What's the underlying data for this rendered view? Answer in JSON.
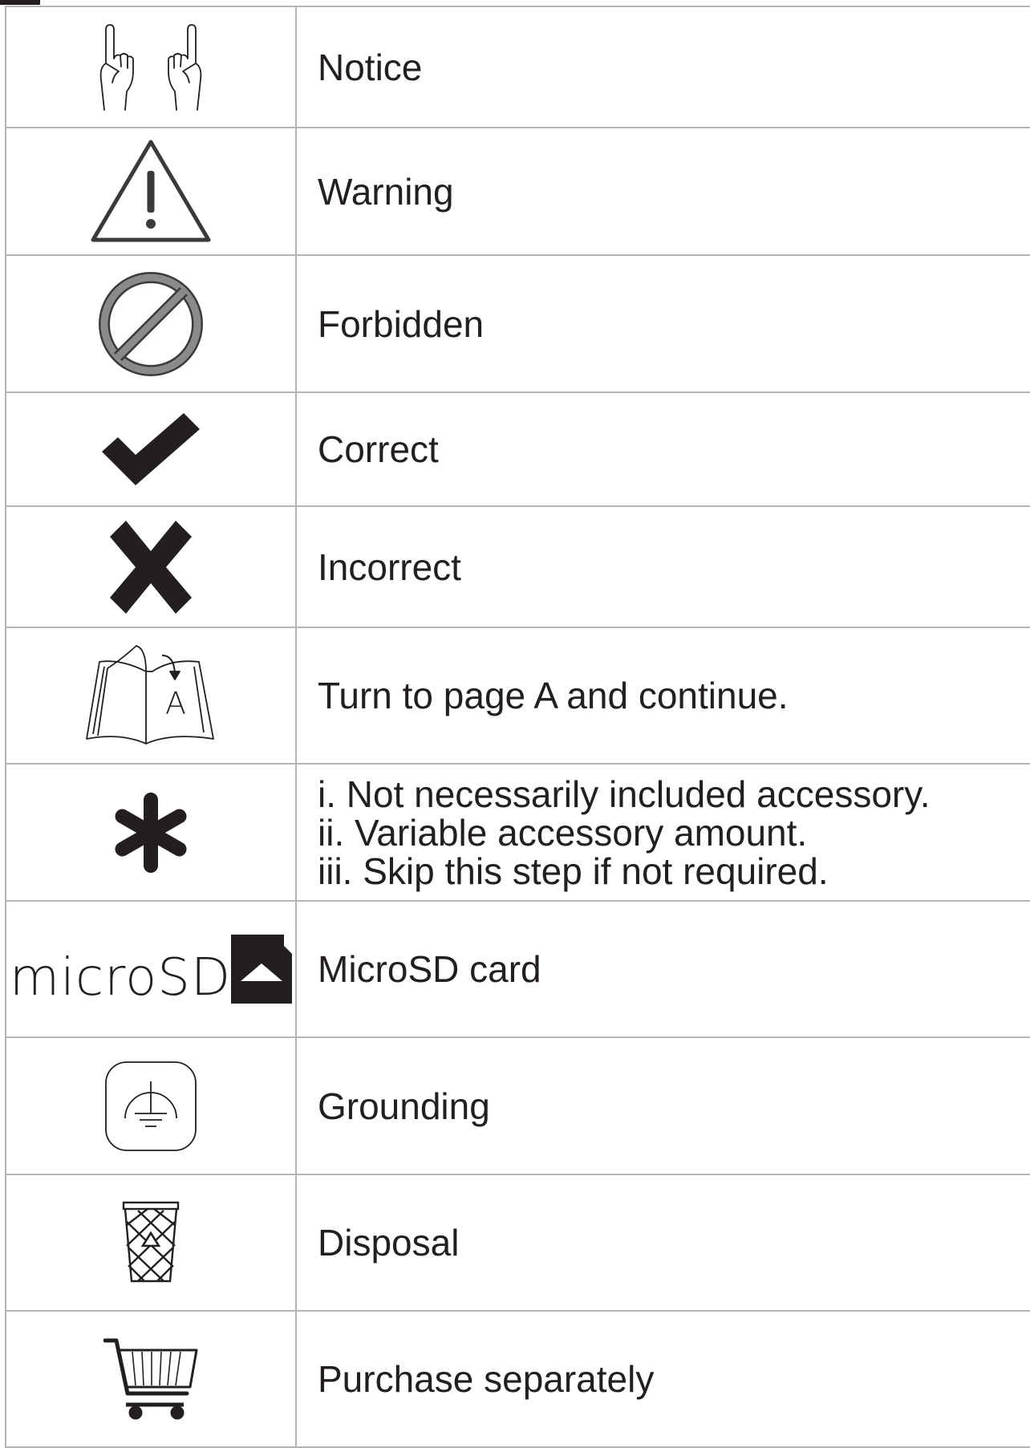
{
  "rows": [
    {
      "icon": "hands-pointing-icon",
      "label": "Notice"
    },
    {
      "icon": "warning-triangle-icon",
      "label": "Warning"
    },
    {
      "icon": "forbidden-icon",
      "label": "Forbidden"
    },
    {
      "icon": "checkmark-icon",
      "label": "Correct"
    },
    {
      "icon": "cross-icon",
      "label": "Incorrect"
    },
    {
      "icon": "open-book-icon",
      "icon_letter": "A",
      "label": "Turn to page A and continue."
    },
    {
      "icon": "asterisk-icon",
      "lines": [
        "i. Not necessarily included accessory.",
        "ii. Variable accessory amount.",
        "iii. Skip this step if not required."
      ]
    },
    {
      "icon": "microsd-card-icon",
      "icon_text": "microSD",
      "label": "MicroSD card"
    },
    {
      "icon": "grounding-icon",
      "label": "Grounding"
    },
    {
      "icon": "disposal-bin-icon",
      "label": "Disposal"
    },
    {
      "icon": "shopping-cart-icon",
      "label": "Purchase separately"
    }
  ],
  "colors": {
    "ink": "#231f20",
    "border": "#b5b5b5",
    "forbidden_gray": "#8a8a8a"
  }
}
